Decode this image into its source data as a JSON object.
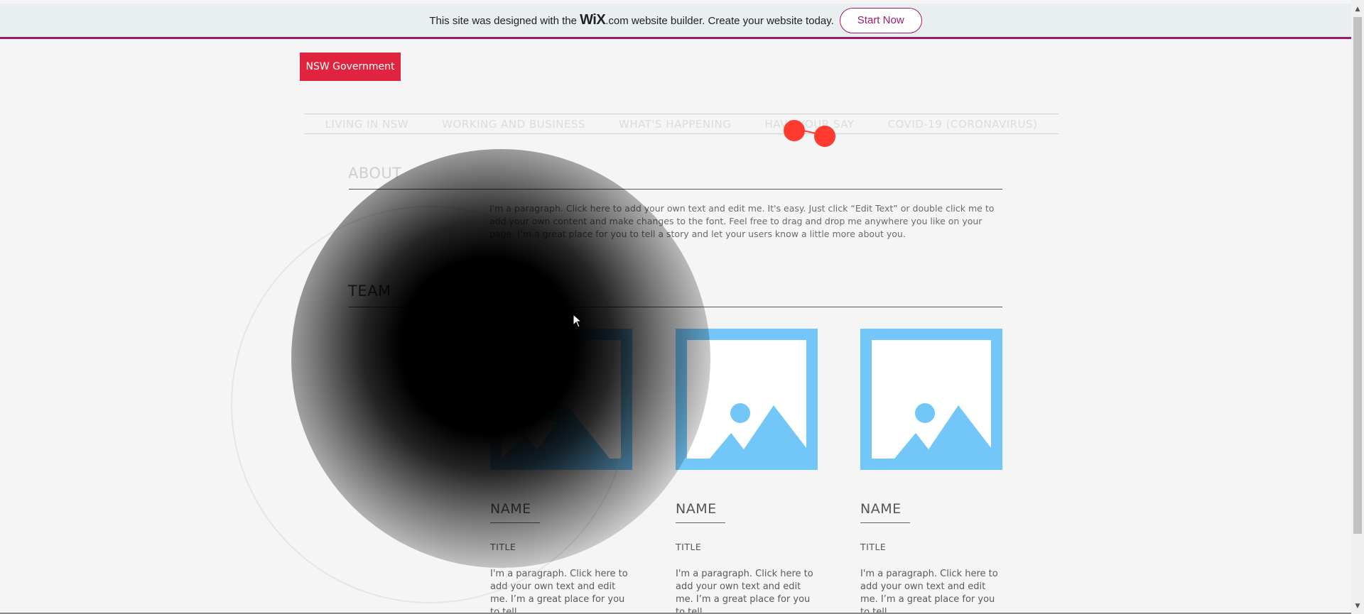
{
  "banner": {
    "text_before": "This site was designed with the",
    "brand": "WiX",
    "brand_suffix": ".com",
    "text_after": "website builder. Create your website today.",
    "cta": "Start Now"
  },
  "logo": {
    "label": "NSW Government",
    "color": "#e0243f"
  },
  "nav": {
    "items": [
      {
        "label": "LIVING IN NSW"
      },
      {
        "label": "WORKING AND BUSINESS"
      },
      {
        "label": "WHAT'S HAPPENING"
      },
      {
        "label": "HAVE YOUR SAY"
      },
      {
        "label": "COVID-19 (CORONAVIRUS)"
      }
    ]
  },
  "about": {
    "title": "ABOUT",
    "text": "I'm a paragraph. Click here to add your own text and edit me. It's easy. Just click “Edit Text” or double click me to add your own content and make changes to the font. Feel free to drag and drop me anywhere you like on your page. I’m a great place for you to tell a story and let your users know a little more about you."
  },
  "team": {
    "title": "TEAM",
    "members": [
      {
        "name": "NAME",
        "title": "TITLE",
        "text": "I'm a paragraph. Click here to add your own text and edit me. I’m a great place for you to tell"
      },
      {
        "name": "NAME",
        "title": "TITLE",
        "text": "I'm a paragraph. Click here to add your own text and edit me. I’m a great place for you to tell"
      },
      {
        "name": "NAME",
        "title": "TITLE",
        "text": "I'm a paragraph. Click here to add your own text and edit me. I’m a great place for you to tell"
      }
    ]
  },
  "colors": {
    "accent": "#9b1c6e",
    "placeholder_blue": "#73c7f8",
    "nav_dot": "#ff3b2f"
  },
  "icons": {
    "placeholder": "image-placeholder-icon",
    "cursor": "mouse-cursor-icon",
    "scroll_up": "chevron-up-icon",
    "scroll_down": "chevron-down-icon"
  }
}
